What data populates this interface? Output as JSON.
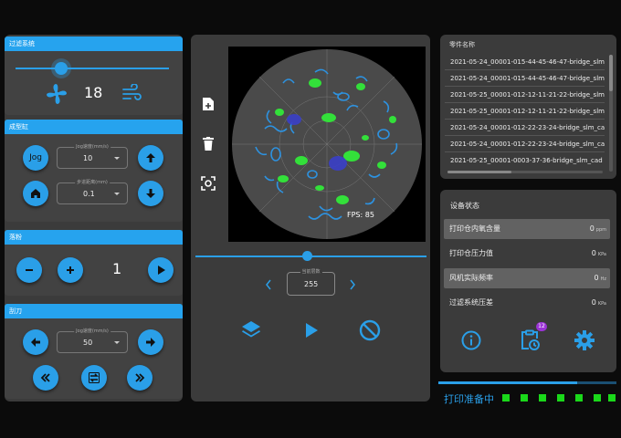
{
  "filter": {
    "title": "过滤系统",
    "slider_value": 0.24,
    "speed": "18"
  },
  "forming_cylinder": {
    "title": "成型缸",
    "jog_label": "Jog",
    "jog_speed_label": "Jog速度(mm/s)",
    "jog_speed_value": "10",
    "step_label": "步进距离(mm)",
    "step_value": "0.1"
  },
  "powder": {
    "title": "落粉",
    "count": "1"
  },
  "scraper": {
    "title": "刮刀",
    "jog_speed_label": "Jog速度(mm/s)",
    "jog_speed_value": "50"
  },
  "viewer": {
    "fps": "FPS: 85",
    "slider_value": 0.48,
    "layer_label": "当前层数",
    "layer_value": "255"
  },
  "parts": {
    "header": "零件名称",
    "items": [
      "2021-05-24_00001-015-44-45-46-47-bridge_slm_cad",
      "2021-05-24_00001-015-44-45-46-47-bridge_slm_cad",
      "2021-05-25_00001-012-12-11-21-22-bridge_slm_cad",
      "2021-05-25_00001-012-12-11-21-22-bridge_slm_cad",
      "2021-05-24_00001-012-22-23-24-bridge_slm_cad",
      "2021-05-24_00001-012-22-23-24-bridge_slm_cad_s",
      "2021-05-25_00001-0003-37-36-bridge_slm_cad"
    ]
  },
  "device_status": {
    "title": "设备状态",
    "rows": [
      {
        "label": "打印仓内氧含量",
        "value": "0",
        "unit": "ppm",
        "highlight": true
      },
      {
        "label": "打印仓压力值",
        "value": "0",
        "unit": "KPa",
        "highlight": false
      },
      {
        "label": "风机实际频率",
        "value": "0",
        "unit": "Hz",
        "highlight": true
      },
      {
        "label": "过滤系统压差",
        "value": "0",
        "unit": "KPa",
        "highlight": false
      }
    ],
    "badge_count": "12"
  },
  "status_bar": {
    "text": "打印准备中",
    "progress": 0.78
  },
  "colors": {
    "accent": "#26a3ee",
    "status_green": "#1ad81a",
    "panel": "#3b3b3b"
  }
}
